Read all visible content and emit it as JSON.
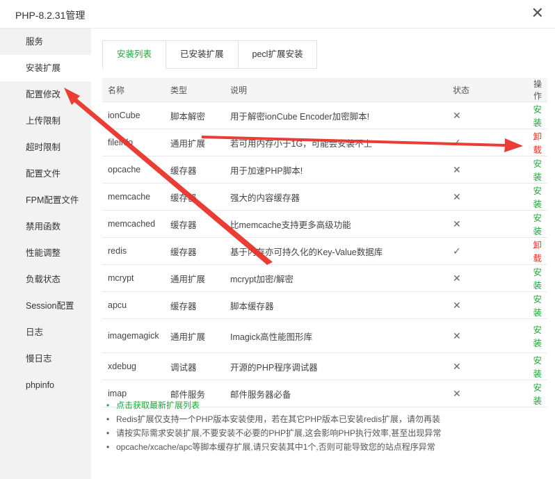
{
  "window": {
    "title": "PHP-8.2.31管理"
  },
  "sidebar": {
    "items": [
      {
        "label": "服务"
      },
      {
        "label": "安装扩展"
      },
      {
        "label": "配置修改"
      },
      {
        "label": "上传限制"
      },
      {
        "label": "超时限制"
      },
      {
        "label": "配置文件"
      },
      {
        "label": "FPM配置文件"
      },
      {
        "label": "禁用函数"
      },
      {
        "label": "性能调整"
      },
      {
        "label": "负载状态"
      },
      {
        "label": "Session配置"
      },
      {
        "label": "日志"
      },
      {
        "label": "慢日志"
      },
      {
        "label": "phpinfo"
      }
    ],
    "active_index": 1
  },
  "tabs": [
    {
      "label": "安装列表"
    },
    {
      "label": "已安装扩展"
    },
    {
      "label": "pecl扩展安装"
    }
  ],
  "table": {
    "headers": {
      "name": "名称",
      "type": "类型",
      "desc": "说明",
      "status": "状态",
      "op": "操作"
    },
    "rows": [
      {
        "name": "ionCube",
        "type": "脚本解密",
        "desc": "用于解密ionCube Encoder加密脚本!",
        "status": "✕",
        "op": "安装"
      },
      {
        "name": "fileinfo",
        "type": "通用扩展",
        "desc": "若可用内存小于1G，可能会安装不上",
        "status": "✓",
        "op": "卸载"
      },
      {
        "name": "opcache",
        "type": "缓存器",
        "desc": "用于加速PHP脚本!",
        "status": "✕",
        "op": "安装"
      },
      {
        "name": "memcache",
        "type": "缓存器",
        "desc": "强大的内容缓存器",
        "status": "✕",
        "op": "安装"
      },
      {
        "name": "memcached",
        "type": "缓存器",
        "desc": "比memcache支持更多高级功能",
        "status": "✕",
        "op": "安装"
      },
      {
        "name": "redis",
        "type": "缓存器",
        "desc": "基于内存亦可持久化的Key-Value数据库",
        "status": "✓",
        "op": "卸载"
      },
      {
        "name": "mcrypt",
        "type": "通用扩展",
        "desc": "mcrypt加密/解密",
        "status": "✕",
        "op": "安装"
      },
      {
        "name": "apcu",
        "type": "缓存器",
        "desc": "脚本缓存器",
        "status": "✕",
        "op": "安装"
      },
      {
        "name": "imagemagick",
        "type": "通用扩展",
        "desc": "Imagick高性能图形库",
        "status": "✕",
        "op": "安装"
      },
      {
        "name": "xdebug",
        "type": "调试器",
        "desc": "开源的PHP程序调试器",
        "status": "✕",
        "op": "安装"
      },
      {
        "name": "imap",
        "type": "邮件服务",
        "desc": "邮件服务器必备",
        "status": "✕",
        "op": "安装"
      }
    ]
  },
  "notes": [
    "点击获取最新扩展列表",
    "Redis扩展仅支持一个PHP版本安装使用，若在其它PHP版本已安装redis扩展，请勿再装",
    "请按实际需求安装扩展,不要安装不必要的PHP扩展,这会影响PHP执行效率,甚至出现异常",
    "opcache/xcache/apc等脚本缓存扩展,请只安装其中1个,否则可能导致您的站点程序异常"
  ],
  "colors": {
    "accent": "#20a53a",
    "danger": "#e2372b",
    "annotation_arrow": "#e8332b"
  }
}
